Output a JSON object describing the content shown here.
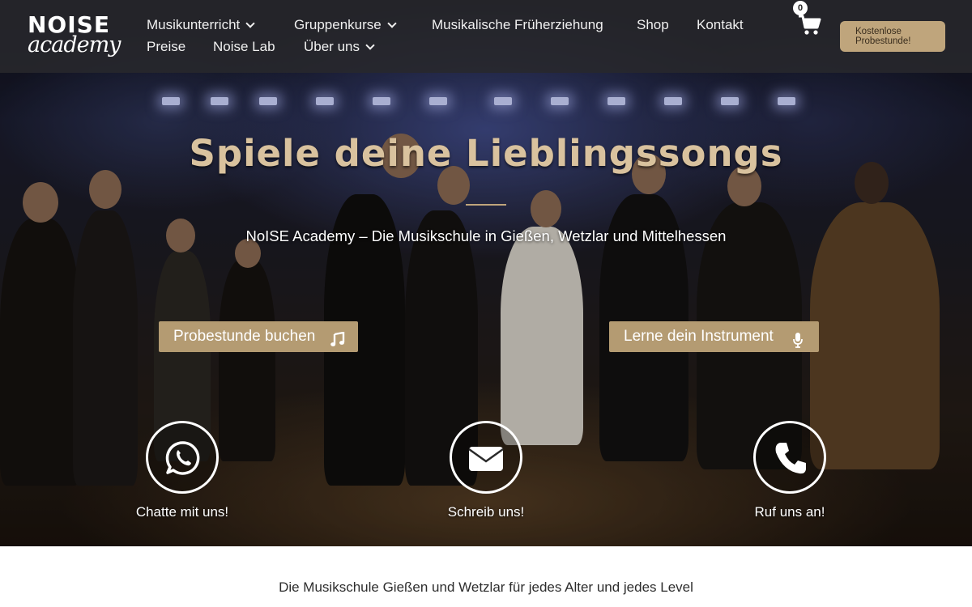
{
  "brand": {
    "logo_line1": "NOISE",
    "logo_line2": "academy"
  },
  "nav": {
    "row1": [
      {
        "label": "Musikunterricht",
        "dropdown": true
      },
      {
        "label": "Gruppenkurse",
        "dropdown": true
      },
      {
        "label": "Musikalische Früherziehung",
        "dropdown": false
      },
      {
        "label": "Shop",
        "dropdown": false
      },
      {
        "label": "Kontakt",
        "dropdown": false
      }
    ],
    "row2": [
      {
        "label": "Preise",
        "dropdown": false
      },
      {
        "label": "Noise Lab",
        "dropdown": false
      },
      {
        "label": "Über uns",
        "dropdown": true
      }
    ]
  },
  "cart": {
    "count": "0",
    "icon": "shopping-cart-icon"
  },
  "cta": {
    "line1": "Kostenlose",
    "line2": "Probestunde!"
  },
  "hero": {
    "headline": "Spiele deine Lieblingssongs",
    "subline": "NoISE Academy – Die Musikschule in Gießen, Wetzlar und Mittelhessen",
    "buttons": [
      {
        "label": "Probestunde buchen",
        "icon": "music-note-icon"
      },
      {
        "label": "Lerne dein Instrument",
        "icon": "microphone-icon"
      }
    ]
  },
  "contact": [
    {
      "label": "Chatte mit uns!",
      "icon": "whatsapp-icon"
    },
    {
      "label": "Schreib uns!",
      "icon": "envelope-icon"
    },
    {
      "label": "Ruf uns an!",
      "icon": "phone-icon"
    }
  ],
  "section": {
    "intro": "Die Musikschule Gießen und Wetzlar für jedes Alter und jedes Level"
  },
  "colors": {
    "accent": "#bfa57c",
    "button": "#b49b72",
    "headline": "#d9c29e",
    "header_bg": "#28282c"
  }
}
